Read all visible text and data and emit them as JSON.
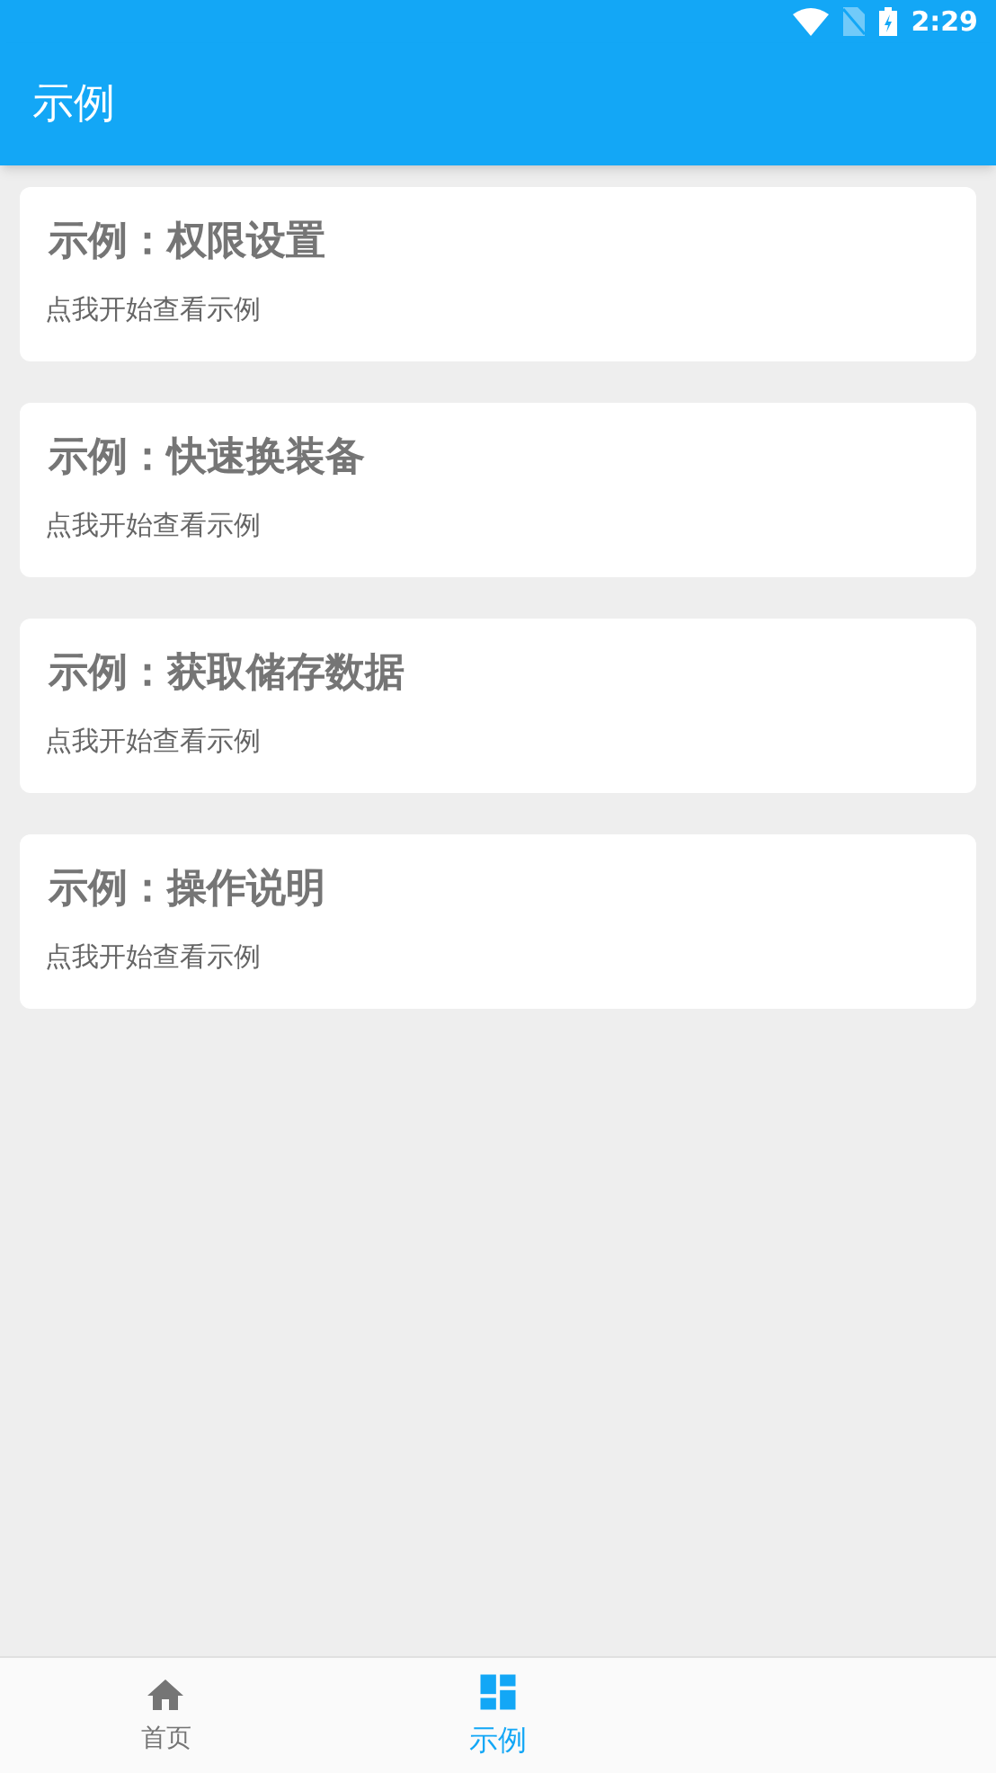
{
  "status_bar": {
    "time": "2:29"
  },
  "app_bar": {
    "title": "示例"
  },
  "cards": [
    {
      "title": "示例：权限设置",
      "subtitle": "点我开始查看示例"
    },
    {
      "title": "示例：快速换装备",
      "subtitle": "点我开始查看示例"
    },
    {
      "title": "示例：获取储存数据",
      "subtitle": "点我开始查看示例"
    },
    {
      "title": "示例：操作说明",
      "subtitle": "点我开始查看示例"
    }
  ],
  "bottom_nav": [
    {
      "label": "首页",
      "kind": "home",
      "selected": false
    },
    {
      "label": "示例",
      "kind": "examples",
      "selected": true
    }
  ]
}
